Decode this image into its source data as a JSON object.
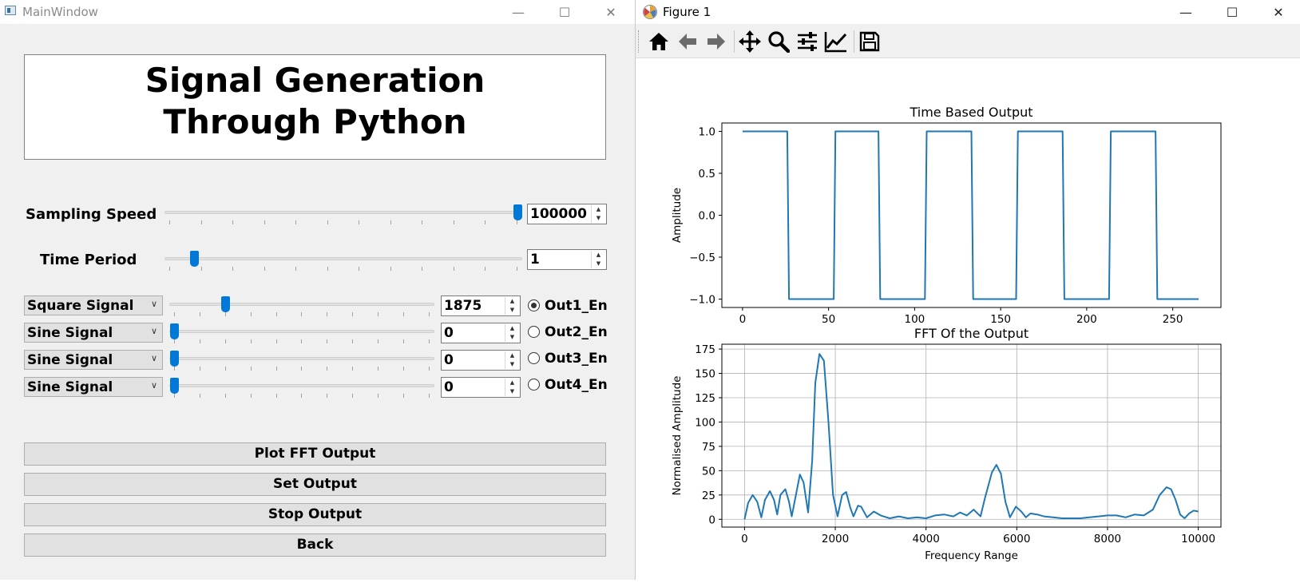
{
  "main_window": {
    "title": "MainWindow",
    "heading_line1": "Signal Generation",
    "heading_line2": "Through Python",
    "sampling_speed": {
      "label": "Sampling Speed",
      "value": "100000",
      "slider_fraction": 1.0
    },
    "time_period": {
      "label": "Time Period",
      "value": "1",
      "slider_fraction": 0.07
    },
    "channels": [
      {
        "signal": "Square Signal",
        "value": "1875",
        "radio": "Out1_En",
        "checked": true,
        "slider_fraction": 0.2
      },
      {
        "signal": "Sine Signal",
        "value": "0",
        "radio": "Out2_En",
        "checked": false,
        "slider_fraction": 0.0
      },
      {
        "signal": "Sine Signal",
        "value": "0",
        "radio": "Out3_En",
        "checked": false,
        "slider_fraction": 0.0
      },
      {
        "signal": "Sine Signal",
        "value": "0",
        "radio": "Out4_En",
        "checked": false,
        "slider_fraction": 0.0
      }
    ],
    "buttons": {
      "plot_fft": "Plot FFT Output",
      "set_output": "Set Output",
      "stop_output": "Stop Output",
      "back": "Back"
    },
    "accent_color": "#0078d7"
  },
  "figure_window": {
    "title": "Figure 1",
    "toolbar_icons": [
      "home-icon",
      "back-arrow-icon",
      "forward-arrow-icon",
      "pan-icon",
      "zoom-icon",
      "subplots-icon",
      "axes-edit-icon",
      "save-icon"
    ]
  },
  "chart_data": [
    {
      "type": "line",
      "title": "Time Based Output",
      "xlabel": "",
      "ylabel": "Amplitude",
      "xlim": [
        -12,
        278
      ],
      "ylim": [
        -1.1,
        1.1
      ],
      "xticks": [
        0,
        50,
        100,
        150,
        200,
        250
      ],
      "yticks": [
        1.0,
        0.5,
        0.0,
        -0.5,
        -1.0
      ],
      "ytick_labels": [
        "1.0",
        "0.5",
        "0.0",
        "−0.5",
        "−1.0"
      ],
      "grid": false,
      "color": "#1f77b4",
      "x": [
        0,
        26,
        27,
        53,
        54,
        79,
        80,
        106,
        107,
        133,
        134,
        159,
        160,
        186,
        187,
        213,
        214,
        240,
        241,
        265
      ],
      "y": [
        1,
        1,
        -1,
        -1,
        1,
        1,
        -1,
        -1,
        1,
        1,
        -1,
        -1,
        1,
        1,
        -1,
        -1,
        1,
        1,
        -1,
        -1
      ]
    },
    {
      "type": "line",
      "title": "FFT Of the Output",
      "xlabel": "Frequency Range",
      "ylabel": "Normalised Amplitude",
      "xlim": [
        -500,
        10500
      ],
      "ylim": [
        -8,
        180
      ],
      "xticks": [
        0,
        2000,
        4000,
        6000,
        8000,
        10000
      ],
      "yticks": [
        0,
        25,
        50,
        75,
        100,
        125,
        150,
        175
      ],
      "grid": true,
      "color": "#1f77b4",
      "x": [
        0,
        80,
        180,
        280,
        370,
        450,
        560,
        650,
        720,
        790,
        900,
        980,
        1040,
        1120,
        1220,
        1300,
        1400,
        1490,
        1560,
        1650,
        1750,
        1850,
        1950,
        2050,
        2150,
        2240,
        2330,
        2400,
        2500,
        2570,
        2700,
        2850,
        3000,
        3200,
        3400,
        3600,
        3800,
        4000,
        4200,
        4400,
        4600,
        4750,
        4900,
        5050,
        5200,
        5300,
        5450,
        5550,
        5650,
        5750,
        5850,
        5980,
        6100,
        6200,
        6300,
        6450,
        6600,
        6800,
        7000,
        7200,
        7400,
        7600,
        7800,
        8000,
        8200,
        8400,
        8600,
        8800,
        9000,
        9150,
        9300,
        9400,
        9500,
        9600,
        9700,
        9800,
        9900,
        10000
      ],
      "y": [
        0,
        17,
        25,
        18,
        2,
        20,
        29,
        20,
        5,
        25,
        31,
        18,
        3,
        22,
        46,
        38,
        7,
        60,
        140,
        170,
        163,
        100,
        25,
        3,
        25,
        28,
        12,
        3,
        14,
        13,
        2,
        8,
        4,
        1,
        3,
        1,
        2,
        1,
        4,
        5,
        3,
        7,
        4,
        10,
        3,
        22,
        48,
        56,
        47,
        18,
        2,
        13,
        8,
        2,
        6,
        5,
        3,
        2,
        1,
        1,
        1,
        2,
        3,
        4,
        4,
        2,
        5,
        4,
        10,
        25,
        33,
        31,
        20,
        5,
        1,
        6,
        9,
        8
      ]
    }
  ]
}
